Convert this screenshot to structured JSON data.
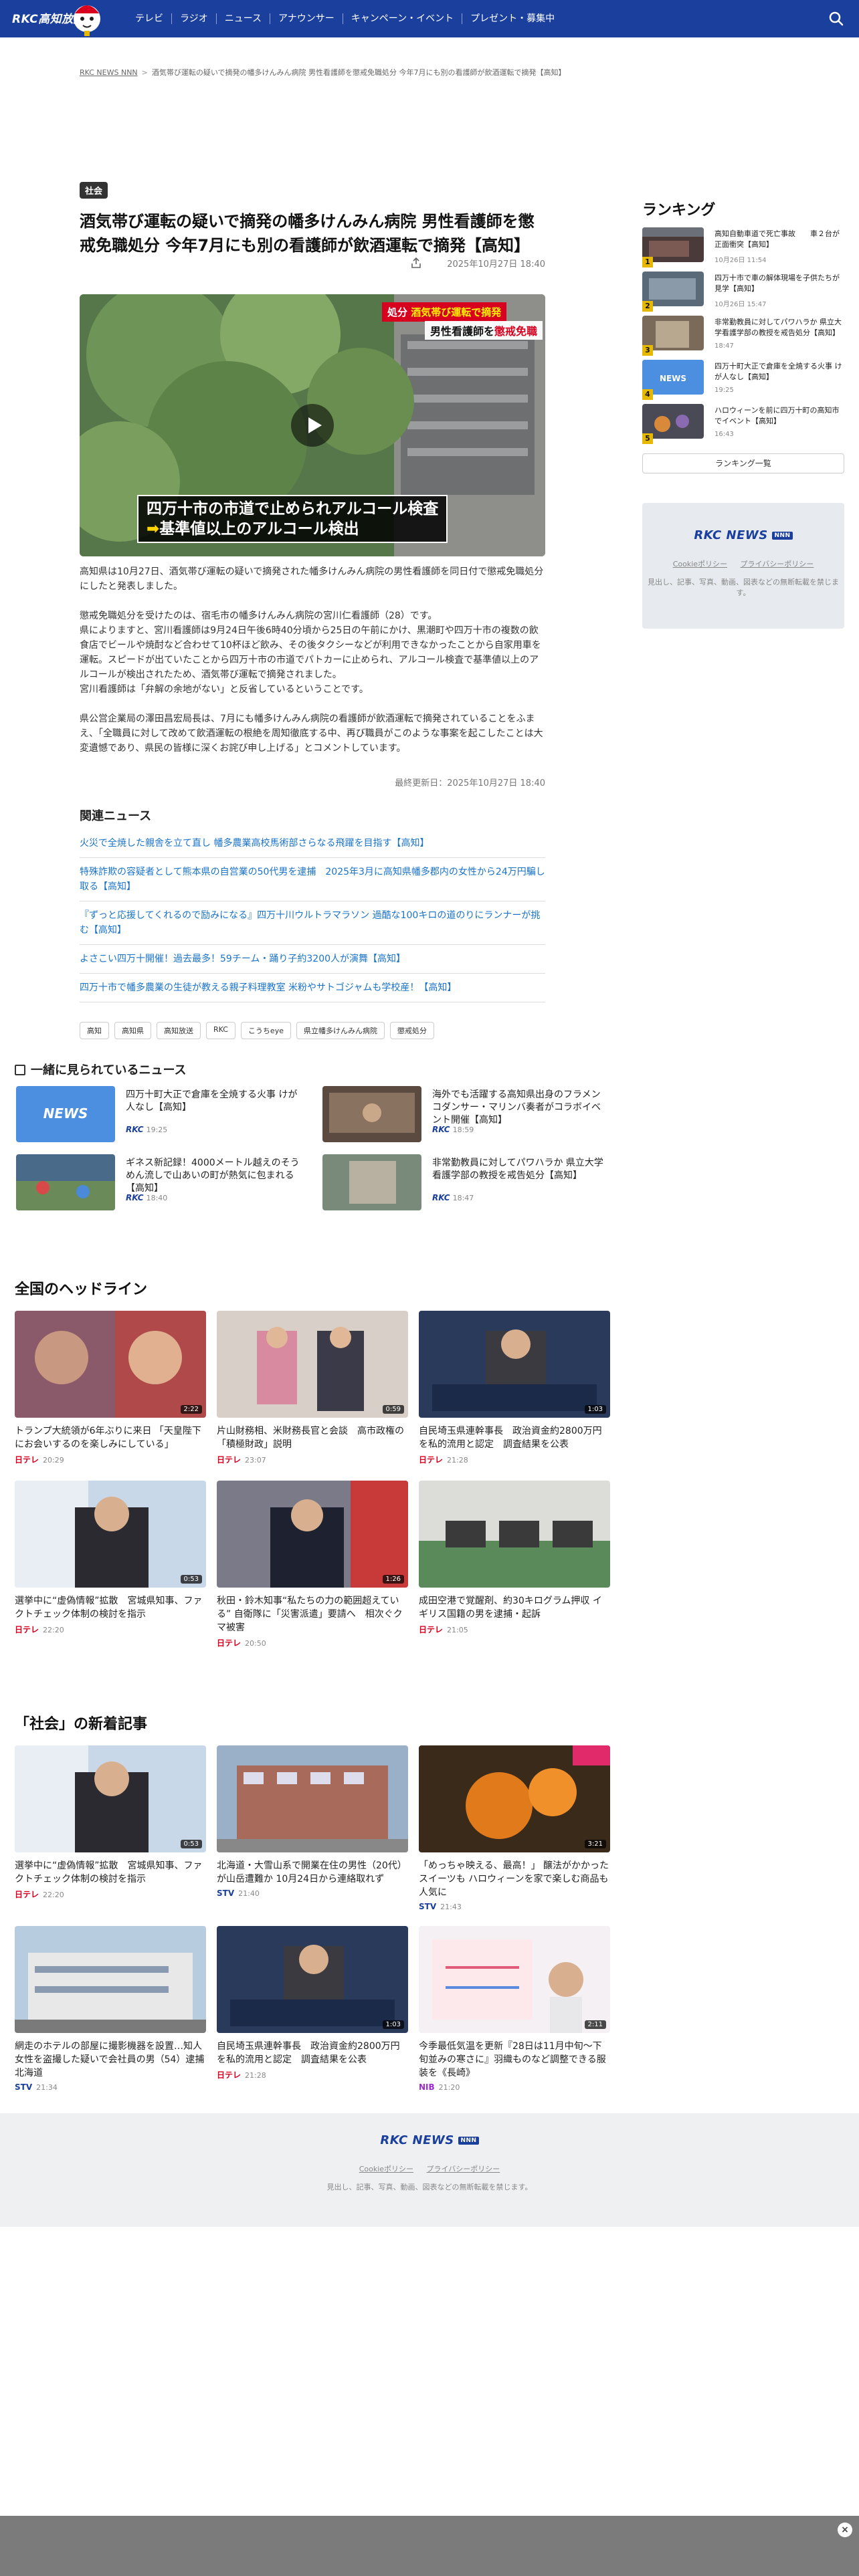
{
  "header": {
    "logo": "RKC高知放送",
    "nav": [
      "テレビ",
      "ラジオ",
      "ニュース",
      "アナウンサー",
      "キャンペーン・イベント",
      "プレゼント・募集中"
    ]
  },
  "breadcrumb": [
    "RKC NEWS NNN",
    "酒気帯び運転の疑いで摘発の幡多けんみん病院 男性看護師を懲戒免職処分 今年7月にも別の看護師が飲酒運転で摘発【高知】"
  ],
  "article": {
    "category": "社会",
    "title": "酒気帯び運転の疑いで摘発の幡多けんみん病院 男性看護師を懲戒免職処分 今年7月にも別の看護師が飲酒運転で摘発【高知】",
    "date": "2025年10月27日 18:40",
    "video": {
      "tag_prefix": "処分",
      "tag_highlight": "酒気帯び運転で摘発",
      "tag_sub_prefix": "男性看護師を",
      "tag_sub_highlight": "懲戒免職",
      "caption1": "四万十市の市道で止められアルコール検査",
      "caption2_arrow": "➡",
      "caption2": "基準値以上のアルコール検出"
    },
    "paragraphs": [
      "高知県は10月27日、酒気帯び運転の疑いで摘発された幡多けんみん病院の男性看護師を同日付で懲戒免職処分にしたと発表しました。",
      "懲戒免職処分を受けたのは、宿毛市の幡多けんみん病院の宮川仁看護師（28）です。\n県によりますと、宮川看護師は9月24日午後6時40分頃から25日の午前にかけ、黒潮町や四万十市の複数の飲食店でビールや焼酎など合わせて10杯ほど飲み、その後タクシーなどが利用できなかったことから自家用車を運転。スピードが出ていたことから四万十市の市道でパトカーに止められ、アルコール検査で基準値以上のアルコールが検出されたため、酒気帯び運転で摘発されました。\n宮川看護師は「弁解の余地がない」と反省しているということです。",
      "県公営企業局の澤田昌宏局長は、7月にも幡多けんみん病院の看護師が飲酒運転で摘発されていることをふまえ、「全職員に対して改めて飲酒運転の根絶を周知徹底する中、再び職員がこのような事案を起こしたことは大変遺憾であり、県民の皆様に深くお詫び申し上げる」とコメントしています。"
    ],
    "updated": "最終更新日：2025年10月27日 18:40"
  },
  "related": {
    "heading": "関連ニュース",
    "items": [
      "火災で全焼した親舎を立て直し 幡多農業高校馬術部さらなる飛躍を目指す【高知】",
      "特殊詐欺の容疑者として熊本県の自営業の50代男を逮捕　2025年3月に高知県幡多郡内の女性から24万円騙し取る【高知】",
      "『ずっと応援してくれるので励みになる』四万十川ウルトラマラソン 過酷な100キロの道のりにランナーが挑む【高知】",
      "よさこい四万十開催！過去最多！59チーム・踊り子約3200人が演舞【高知】",
      "四万十市で幡多農業の生徒が教える親子料理教室 米粉やサトゴジャムも学校産！【高知】"
    ]
  },
  "tags": [
    "高知",
    "高知県",
    "高知放送",
    "RKC",
    "こうちeye",
    "県立幡多けんみん病院",
    "懲戒処分"
  ],
  "ranking": {
    "heading": "ランキング",
    "items": [
      {
        "num": "1",
        "title": "高知自動車道で死亡事故　　車２台が正面衝突【高知】",
        "date": "10月26日 11:54"
      },
      {
        "num": "2",
        "title": "四万十市で車の解体現場を子供たちが見学【高知】",
        "date": "10月26日 15:47"
      },
      {
        "num": "3",
        "title": "非常勤教員に対してパワハラか 県立大学看護学部の教授を戒告処分【高知】",
        "date": "18:47"
      },
      {
        "num": "4",
        "title": "四万十町大正で倉庫を全焼する火事 けが人なし【高知】",
        "date": "19:25"
      },
      {
        "num": "5",
        "title": "ハロウィーンを前に四万十町の高知市でイベント【高知】",
        "date": "16:43"
      }
    ],
    "more": "ランキング一覧"
  },
  "side_footer": {
    "brand": "RKC NEWS",
    "brand_badge": "NNN",
    "links": [
      "Cookieポリシー",
      "プライバシーポリシー"
    ],
    "copy": "見出し、記事、写真、動画、図表などの無断転載を禁じます。"
  },
  "together": {
    "heading": "一緒に見られているニュース",
    "items": [
      {
        "title": "四万十町大正で倉庫を全焼する火事 けが人なし【高知】",
        "src": "RKC",
        "time": "19:25"
      },
      {
        "title": "海外でも活躍する高知県出身のフラメンコダンサー・マリンバ奏者がコラボイベント開催【高知】",
        "src": "RKC",
        "time": "18:59"
      },
      {
        "title": "ギネス新記録！4000メートル越えのそうめん流しで山あいの町が熱気に包まれる【高知】",
        "src": "RKC",
        "time": "18:40"
      },
      {
        "title": "非常勤教員に対してパワハラか 県立大学看護学部の教授を戒告処分【高知】",
        "src": "RKC",
        "time": "18:47"
      }
    ]
  },
  "national": {
    "heading": "全国のヘッドライン",
    "items": [
      {
        "title": "トランプ大統領が6年ぶりに来日 「天皇陛下にお会いするのを楽しみにしている」",
        "src": "日テレ",
        "time": "20:29",
        "dur": "2:22"
      },
      {
        "title": "片山財務相、米財務長官と会談　高市政権の「積極財政」説明",
        "src": "日テレ",
        "time": "23:07",
        "dur": "0:59"
      },
      {
        "title": "自民埼玉県連幹事長　政治資金約2800万円を私的流用と認定　調査結果を公表",
        "src": "日テレ",
        "time": "21:28",
        "dur": "1:03"
      },
      {
        "title": "選挙中に“虚偽情報”拡散　宮城県知事、ファクトチェック体制の検討を指示",
        "src": "日テレ",
        "time": "22:20",
        "dur": "0:53"
      },
      {
        "title": "秋田・鈴木知事“私たちの力の範囲超えている” 自衛隊に「災害派遣」要請へ　相次ぐクマ被害",
        "src": "日テレ",
        "time": "20:50",
        "dur": "1:26"
      },
      {
        "title": "成田空港で覚醒剤、約30キログラム押収 イギリス国籍の男を逮捕・起訴",
        "src": "日テレ",
        "time": "21:05",
        "dur": ""
      }
    ]
  },
  "society": {
    "heading": "「社会」の新着記事",
    "items": [
      {
        "title": "選挙中に“虚偽情報”拡散　宮城県知事、ファクトチェック体制の検討を指示",
        "src": "日テレ",
        "time": "22:20",
        "dur": "0:53"
      },
      {
        "title": "北海道・大雪山系で開業在住の男性（20代）が山岳遭難か 10月24日から連絡取れず",
        "src": "STV",
        "time": "21:40",
        "dur": ""
      },
      {
        "title": "「めっちゃ映える、最高！」 醸法がかかったスイーツも ハロウィーンを家で楽しむ商品も人気に",
        "src": "STV",
        "time": "21:43",
        "dur": "3:21"
      },
      {
        "title": "網走のホテルの部屋に撮影機器を設置…知人女性を盗撮した疑いで会社員の男（54）逮捕 北海道",
        "src": "STV",
        "time": "21:34",
        "dur": ""
      },
      {
        "title": "自民埼玉県連幹事長　政治資金約2800万円を私的流用と認定　調査結果を公表",
        "src": "日テレ",
        "time": "21:28",
        "dur": "1:03"
      },
      {
        "title": "今季最低気温を更新『28日は11月中旬～下旬並みの寒さに』羽織ものなど調整できる服装を《長崎》",
        "src": "NIB",
        "time": "21:20",
        "dur": "2:11"
      }
    ]
  },
  "footer": {
    "brand": "RKC NEWS",
    "brand_badge": "NNN",
    "links": [
      "Cookieポリシー",
      "プライバシーポリシー"
    ],
    "copy": "見出し、記事、写真、動画、図表などの無断転載を禁じます。"
  },
  "colors": {
    "header": "#1b3f9c",
    "link": "#1a73c8",
    "ntv": "#d8001f"
  }
}
